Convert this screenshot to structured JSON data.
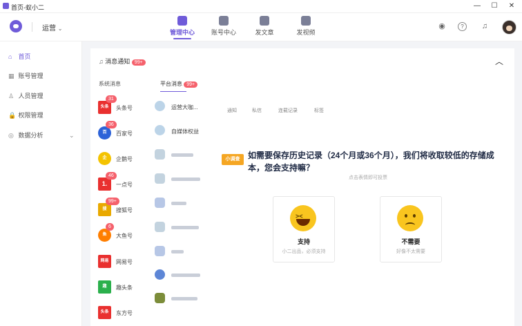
{
  "window": {
    "title": "首页-蚁小二",
    "minimize": "—",
    "maximize": "☐",
    "close": "✕"
  },
  "header": {
    "workspace": "运营",
    "nav": [
      {
        "label": "管理中心",
        "active": true
      },
      {
        "label": "账号中心",
        "active": false
      },
      {
        "label": "发文章",
        "active": false
      },
      {
        "label": "发视频",
        "active": false
      }
    ],
    "icons": [
      "robot-icon",
      "help-icon",
      "bell-icon",
      "avatar"
    ]
  },
  "sidebar": {
    "items": [
      {
        "icon": "⌂",
        "label": "首页",
        "active": true
      },
      {
        "icon": "▦",
        "label": "账号管理",
        "active": false
      },
      {
        "icon": "♙",
        "label": "人员管理",
        "active": false
      },
      {
        "icon": "🔒",
        "label": "权限管理",
        "active": false
      },
      {
        "icon": "◎",
        "label": "数据分析",
        "active": false,
        "expand": "⌄"
      }
    ]
  },
  "panel": {
    "title": "消息通知",
    "title_badge": "99+",
    "collapse": "︿",
    "sys_tab": "系统消息",
    "plat_tab": "平台消息",
    "plat_badge": "99+",
    "platforms": [
      {
        "logo": "头条",
        "name": "头条号",
        "badge": "31",
        "color": "#e9302f"
      },
      {
        "logo": "百",
        "name": "百家号",
        "badge": "36",
        "color": "#e9302f"
      },
      {
        "logo": "企",
        "name": "企鹅号",
        "badge": "",
        "color": "#f4c300"
      },
      {
        "logo": "1.",
        "name": "一点号",
        "badge": "46",
        "color": "#e9302f"
      },
      {
        "logo": "搜",
        "name": "搜狐号",
        "badge": "99+",
        "color": "#e9a900"
      },
      {
        "logo": "鱼",
        "name": "大鱼号",
        "badge": "6",
        "color": "#ff7e00"
      },
      {
        "logo": "网易",
        "name": "网易号",
        "badge": "",
        "color": "#e9302f"
      },
      {
        "logo": "趣",
        "name": "趣头条",
        "badge": "",
        "color": "#2bb04c"
      },
      {
        "logo": "头条",
        "name": "东方号",
        "badge": "",
        "color": "#e9302f"
      }
    ],
    "messages": [
      {
        "name": "运营大咖...",
        "color": "#a8c7e0"
      },
      {
        "name": "自媒体权益",
        "color": "#a8c7e0"
      }
    ],
    "sub_tabs": [
      "通知",
      "私信",
      "连载记录",
      "标签"
    ],
    "survey": {
      "logo": "小调查",
      "question": "如需要保存历史记录（24个月或36个月），我们将收取较低的存储成本，您会支持嘛？",
      "hint": "点击表情即可投票",
      "options": [
        {
          "title": "支持",
          "sub": "小二出品，必须支持"
        },
        {
          "title": "不需要",
          "sub": "好像不太需要"
        }
      ]
    }
  }
}
